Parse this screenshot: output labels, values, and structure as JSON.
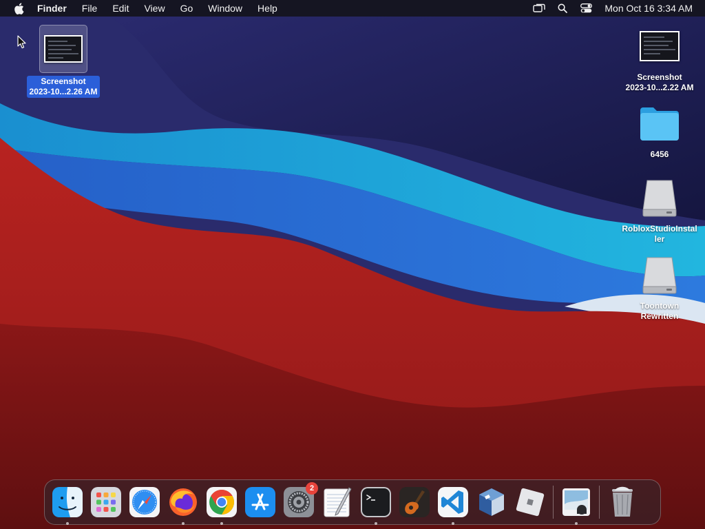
{
  "menubar": {
    "app_name": "Finder",
    "menus": [
      "File",
      "Edit",
      "View",
      "Go",
      "Window",
      "Help"
    ],
    "clock": "Mon Oct 16  3:34 AM",
    "status_icons": [
      "screen-mirroring-icon",
      "spotlight-search-icon",
      "control-center-icon"
    ]
  },
  "desktop": {
    "icons": [
      {
        "line1": "Screenshot",
        "line2": "2023-10...2.26 AM",
        "kind": "screenshot",
        "selected": true
      },
      {
        "line1": "Screenshot",
        "line2": "2023-10...2.22 AM",
        "kind": "screenshot",
        "selected": false
      },
      {
        "line1": "6456",
        "line2": "",
        "kind": "folder",
        "selected": false
      },
      {
        "line1": "RobloxStudioInstal",
        "line2": "ler",
        "kind": "disk-image",
        "selected": false
      },
      {
        "line1": "Toontown",
        "line2": "Rewritten",
        "kind": "disk-image",
        "selected": false
      }
    ]
  },
  "dock": {
    "items": [
      "finder-icon",
      "launchpad-icon",
      "safari-icon",
      "firefox-icon",
      "chrome-icon",
      "app-store-icon",
      "system-settings-icon",
      "textedit-icon",
      "terminal-icon",
      "garageband-icon",
      "vscode-icon",
      "virtualbox-icon",
      "roblox-icon",
      "preview-icon",
      "trash-icon"
    ],
    "settings_badge": "2"
  },
  "colors": {
    "navy": "#1e1f5a",
    "cyan": "#1fa8d9",
    "blue": "#2a6fd4",
    "red": "#b2201e",
    "dark_red": "#7a1414",
    "selection": "#2b5fd9"
  }
}
